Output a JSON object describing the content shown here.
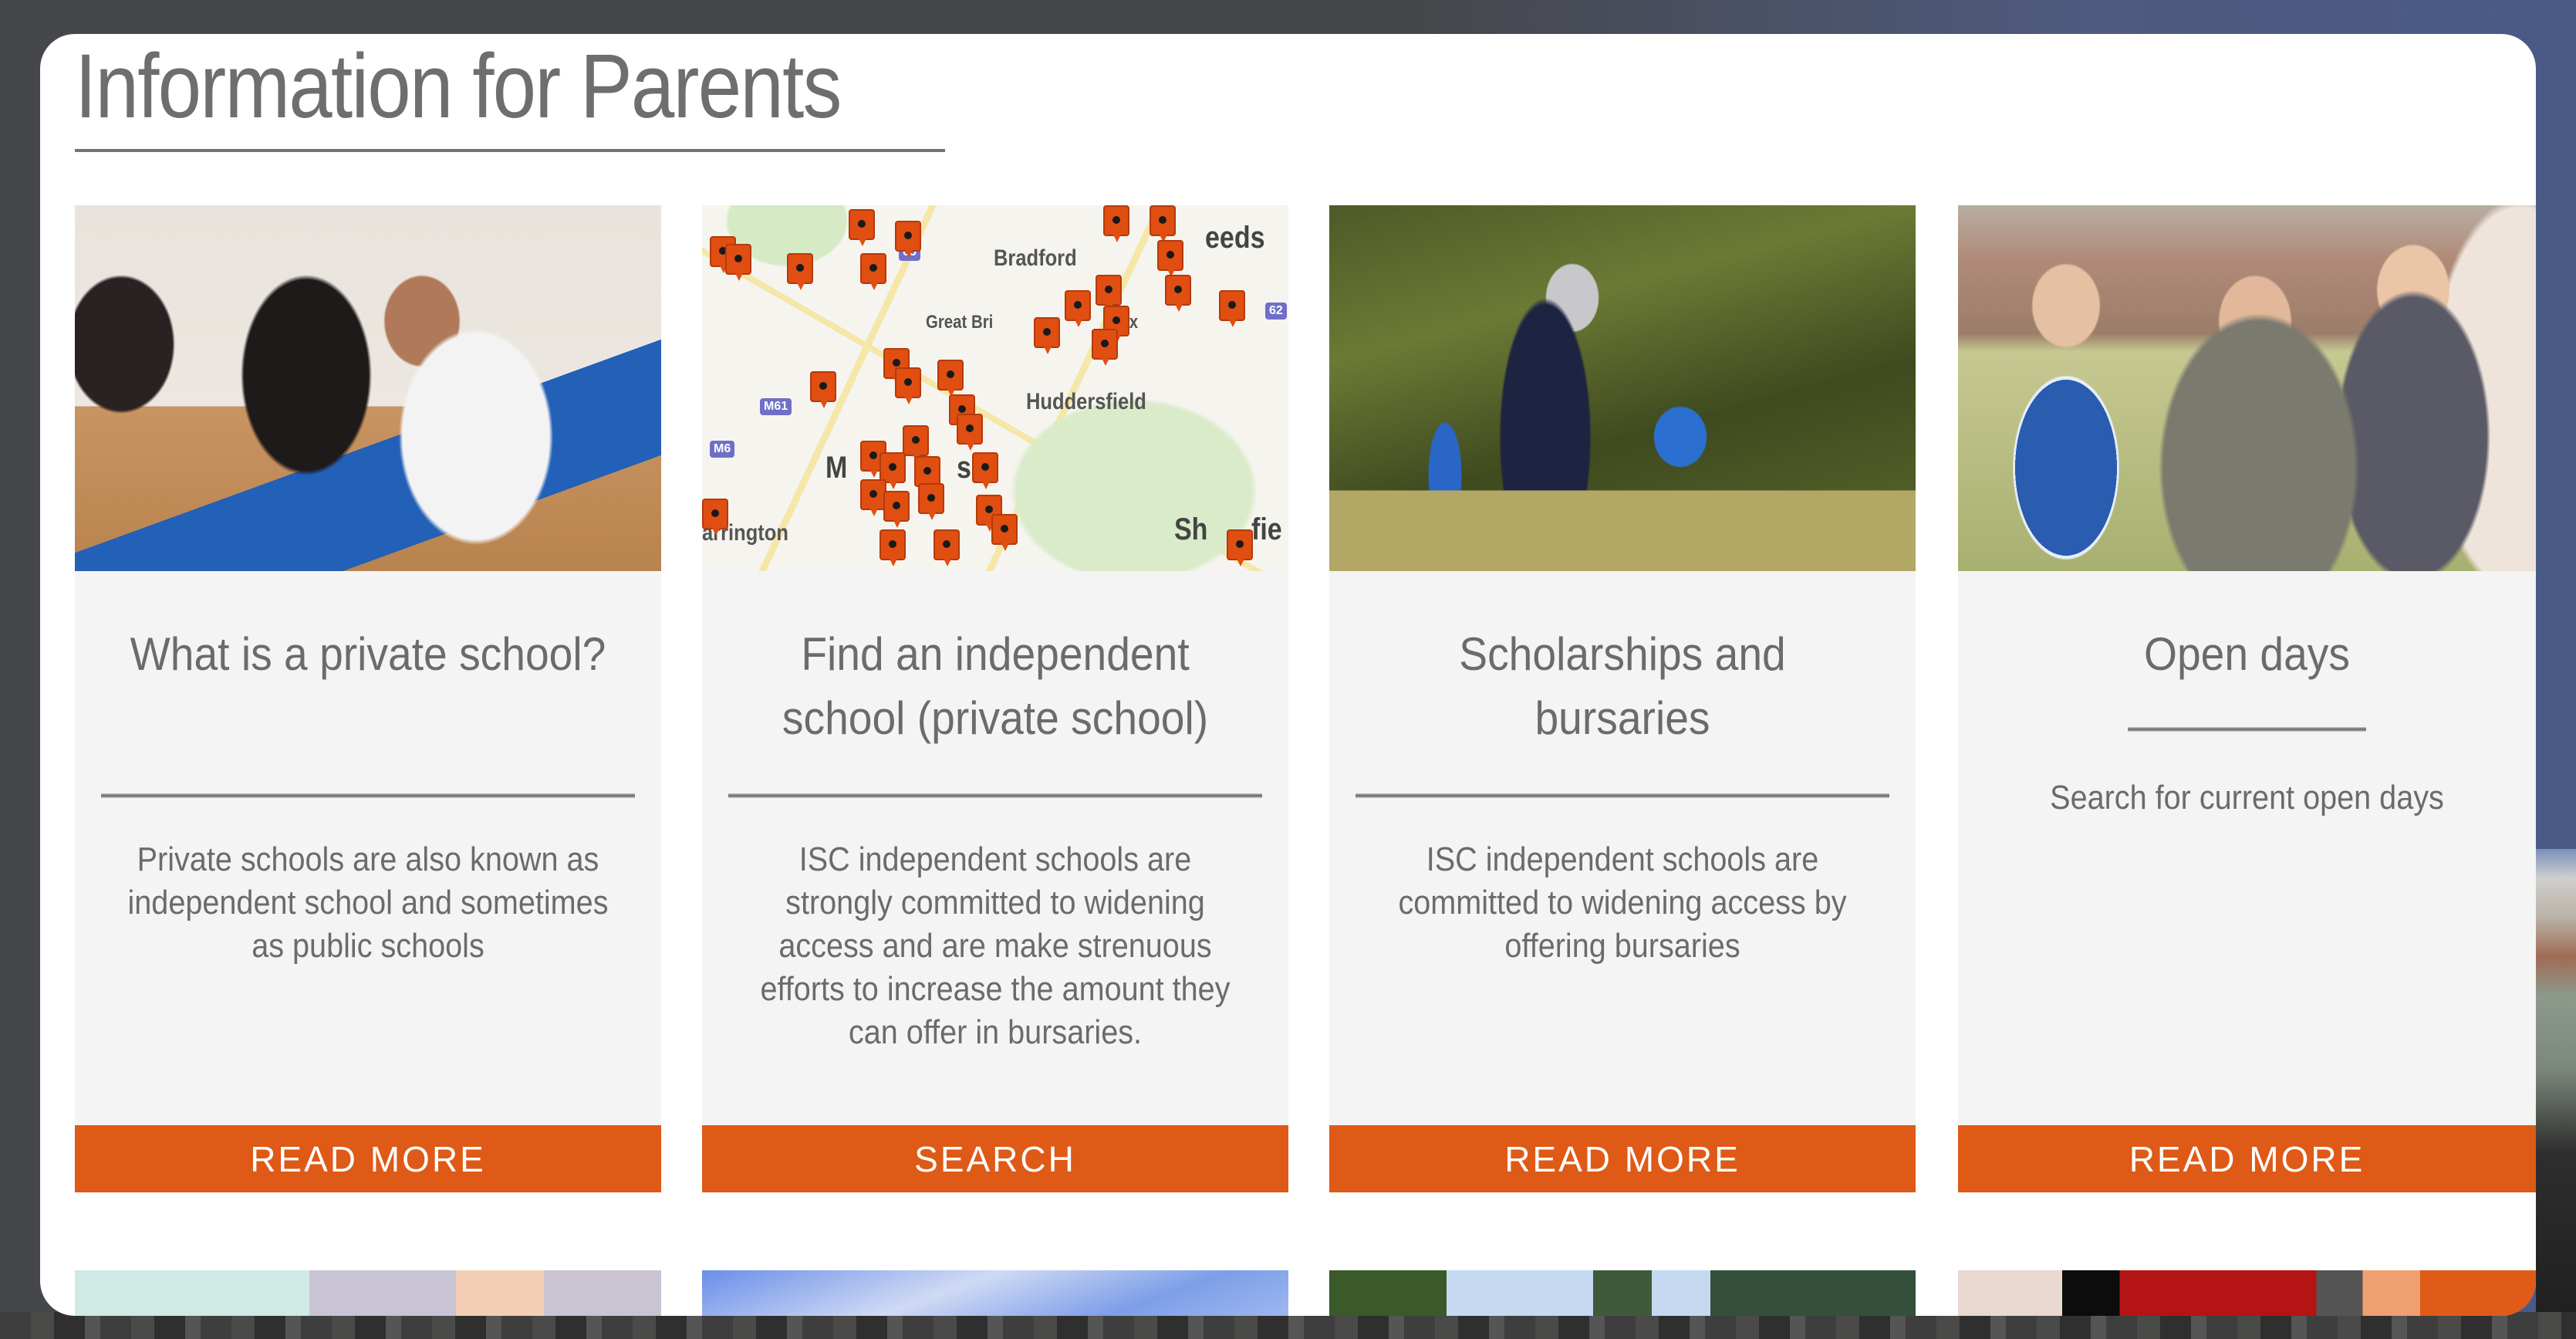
{
  "page": {
    "title": "Information for Parents"
  },
  "colors": {
    "accent": "#de5a16",
    "card_background": "#f4f4f4",
    "text": "#6b6b6b",
    "rule": "#737373"
  },
  "cards": [
    {
      "title": "What is a private school?",
      "description": "Private schools are also known as independent school and sometimes as public schools",
      "button": "READ MORE",
      "image": "students-reading-classroom-photo"
    },
    {
      "title": "Find an independent school (private school)",
      "description": "ISC independent schools are strongly committed to widening access and are make strenuous efforts to increase the amount they can offer in bursaries.",
      "button": "SEARCH",
      "image": "school-locations-map",
      "map_labels": {
        "bradford": "Bradford",
        "leeds": "eeds",
        "great_britain": "Great Bri",
        "huddersfield": "Huddersfield",
        "manchester": "M",
        "manchester_end": "s",
        "warrington": "arrington",
        "sheffield": "Sh",
        "sheffield_end": "fie",
        "halifax": "ifax",
        "m61": "M61",
        "m6": "M6",
        "m62": "62",
        "m65": "65"
      }
    },
    {
      "title": "Scholarships and bursaries",
      "description": "ISC independent schools are committed to widening access by offering bursaries",
      "button": "READ MORE",
      "image": "cricket-player-photo"
    },
    {
      "title": "Open days",
      "description": "Search for current open days",
      "button": "READ MORE",
      "image": "smiling-students-photo"
    }
  ]
}
